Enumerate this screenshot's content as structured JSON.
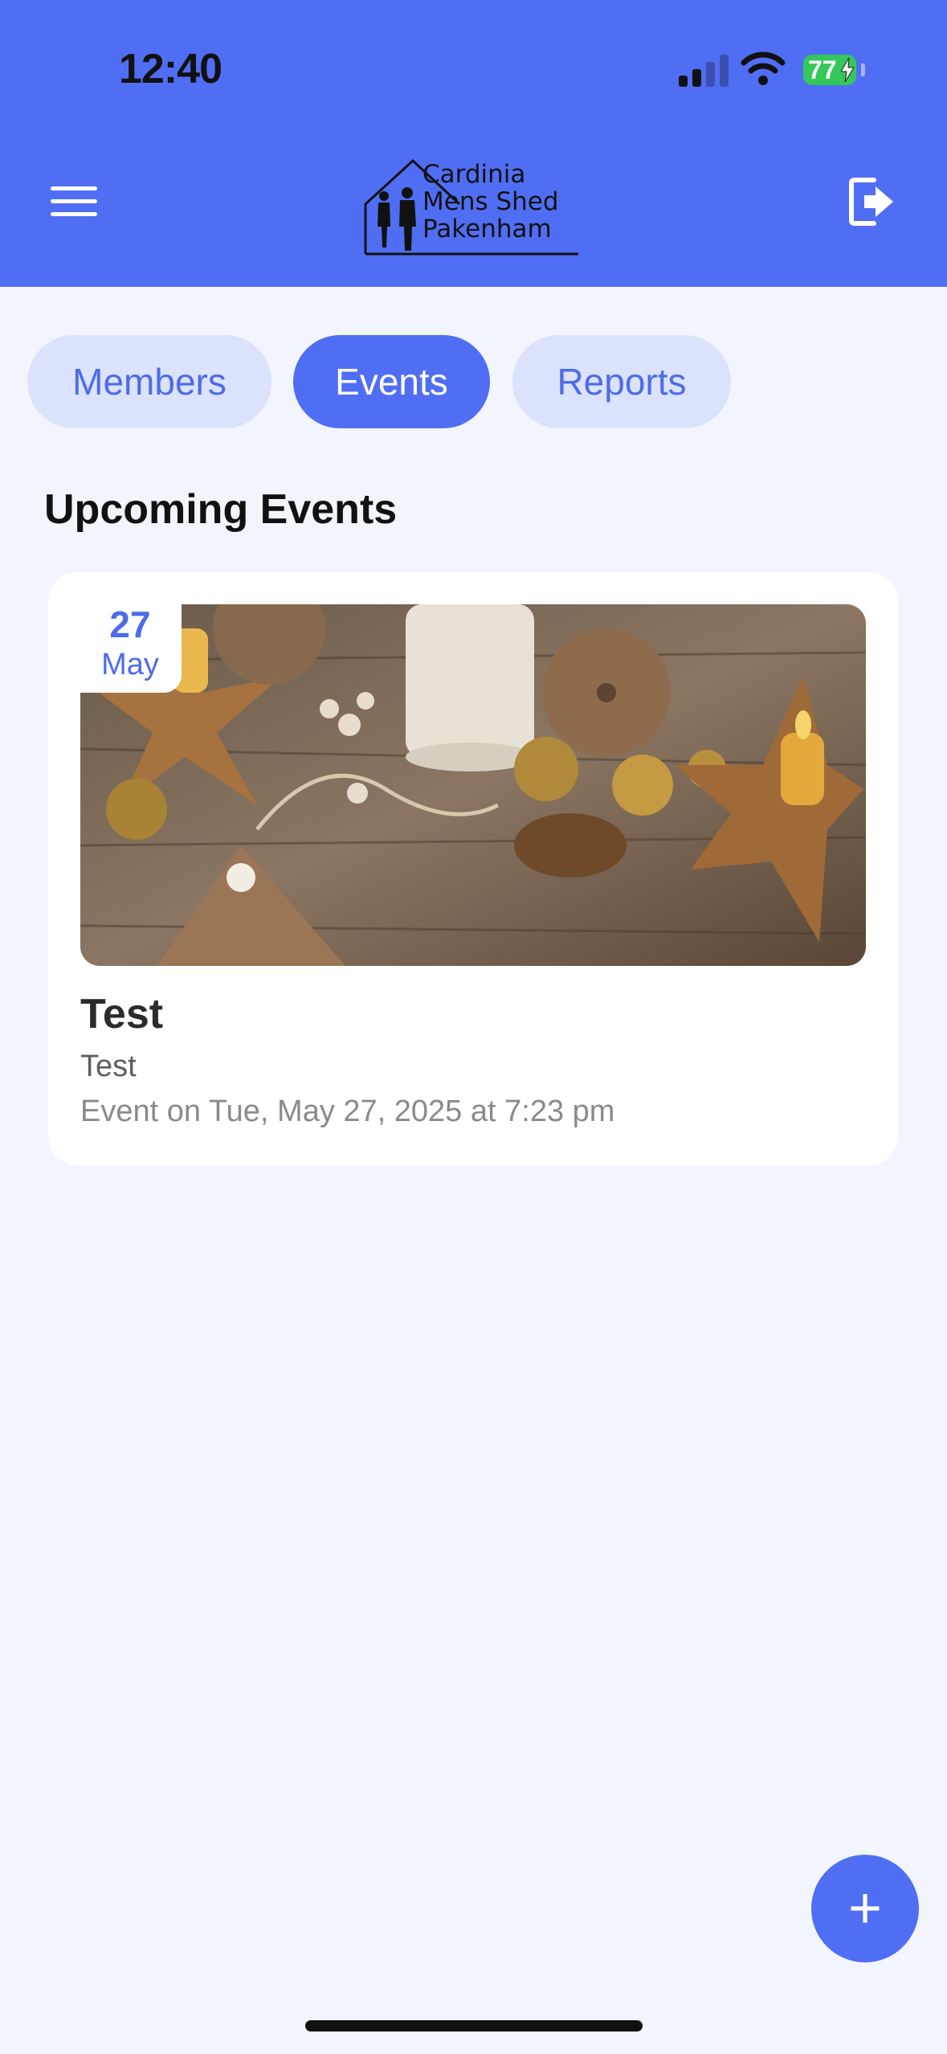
{
  "status_bar": {
    "time": "12:40",
    "battery": "77"
  },
  "header": {
    "logo_text": "Cardinia\nMens Shed\nPakenham",
    "icons": {
      "menu": "hamburger-icon",
      "logout": "logout-icon"
    },
    "accent_color": "#506ef4"
  },
  "tabs": [
    {
      "label": "Members",
      "active": false
    },
    {
      "label": "Events",
      "active": true
    },
    {
      "label": "Reports",
      "active": false
    }
  ],
  "section": {
    "title": "Upcoming Events"
  },
  "events": [
    {
      "day": "27",
      "month": "May",
      "title": "Test",
      "description": "Test",
      "when": "Event on Tue, May 27, 2025 at 7:23 pm"
    }
  ],
  "fab": {
    "label": "+",
    "icon": "plus-icon"
  }
}
